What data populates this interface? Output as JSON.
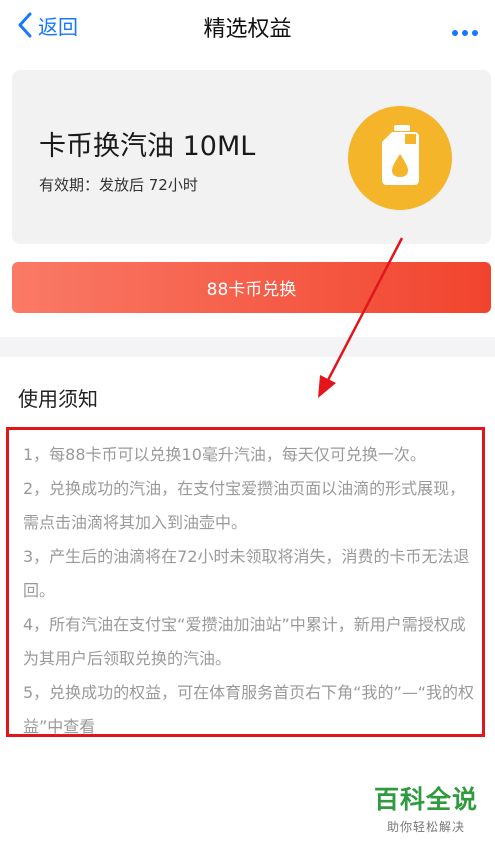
{
  "nav": {
    "back_label": "返回",
    "title": "精选权益"
  },
  "card": {
    "title": "卡币换汽油 10ML",
    "validity": "有效期：发放后 72小时"
  },
  "redeem_button": {
    "label": "88卡币兑换"
  },
  "notice": {
    "title": "使用须知",
    "items": [
      "1，每88卡币可以兑换10毫升汽油，每天仅可兑换一次。",
      "2，兑换成功的汽油，在支付宝爱攒油页面以油滴的形式展现，需点击油滴将其加入到油壶中。",
      "3，产生后的油滴将在72小时未领取将消失，消费的卡币无法退回。",
      "4，所有汽油在支付宝“爱攒油加油站”中累计，新用户需授权成为其用户后领取兑换的汽油。",
      "5，兑换成功的权益，可在体育服务首页右下角“我的”—“我的权益”中查看"
    ]
  },
  "watermark": {
    "main": "百科全说",
    "sub": "助你轻松解决"
  },
  "colors": {
    "accent_blue": "#1677ff",
    "button_gradient_start": "#fa7a66",
    "button_gradient_end": "#f1442e",
    "highlight_red": "#e4141b",
    "badge_orange": "#f5b52a",
    "watermark_green": "#2f9a3e"
  },
  "icons": {
    "back": "chevron-left-icon",
    "more": "more-dots-icon",
    "badge": "oil-can-icon"
  }
}
